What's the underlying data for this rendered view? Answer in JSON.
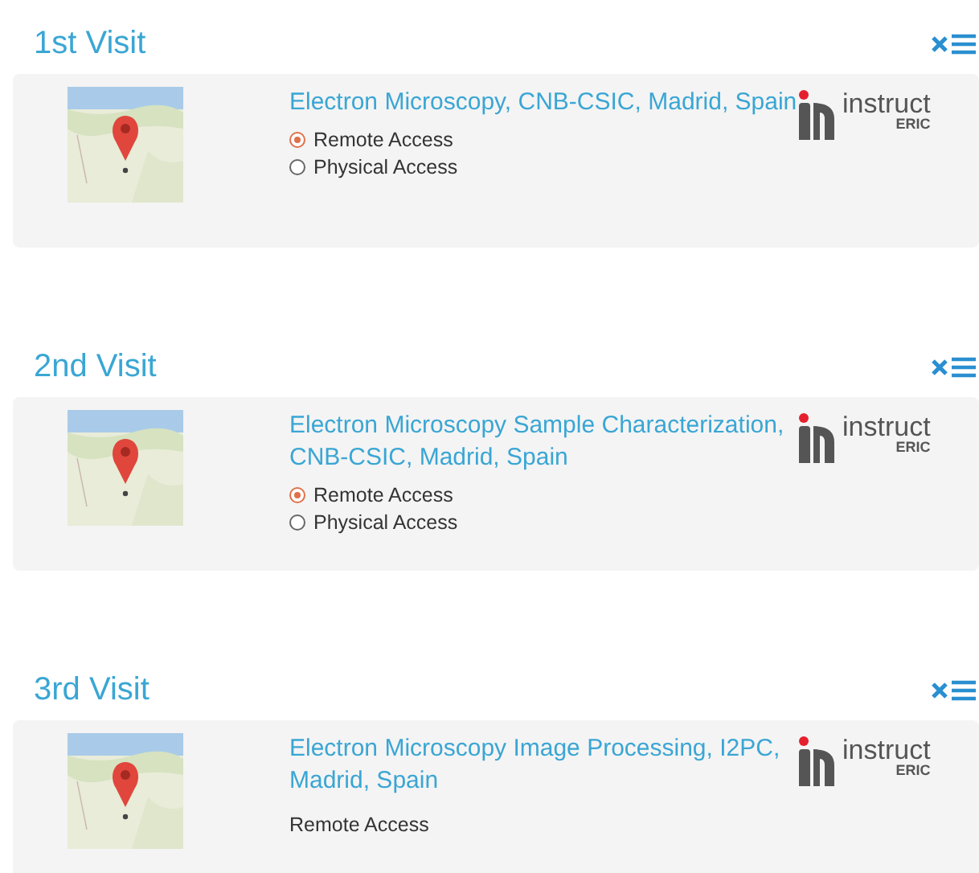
{
  "visits": [
    {
      "title": "1st Visit",
      "facility": "Electron Microscopy, CNB-CSIC, Madrid, Spain",
      "logo": {
        "name": "instruct",
        "sub": "ERIC"
      },
      "access": {
        "kind": "radios",
        "options": [
          {
            "label": "Remote Access",
            "selected": true
          },
          {
            "label": "Physical Access",
            "selected": false
          }
        ]
      }
    },
    {
      "title": "2nd Visit",
      "facility": "Electron Microscopy Sample Characterization, CNB-CSIC, Madrid, Spain",
      "logo": {
        "name": "instruct",
        "sub": "ERIC"
      },
      "access": {
        "kind": "radios",
        "options": [
          {
            "label": "Remote Access",
            "selected": true
          },
          {
            "label": "Physical Access",
            "selected": false
          }
        ]
      }
    },
    {
      "title": "3rd Visit",
      "facility": "Electron Microscopy Image Processing, I2PC, Madrid, Spain",
      "logo": {
        "name": "instruct",
        "sub": "ERIC"
      },
      "access": {
        "kind": "text",
        "label": "Remote Access"
      }
    }
  ]
}
